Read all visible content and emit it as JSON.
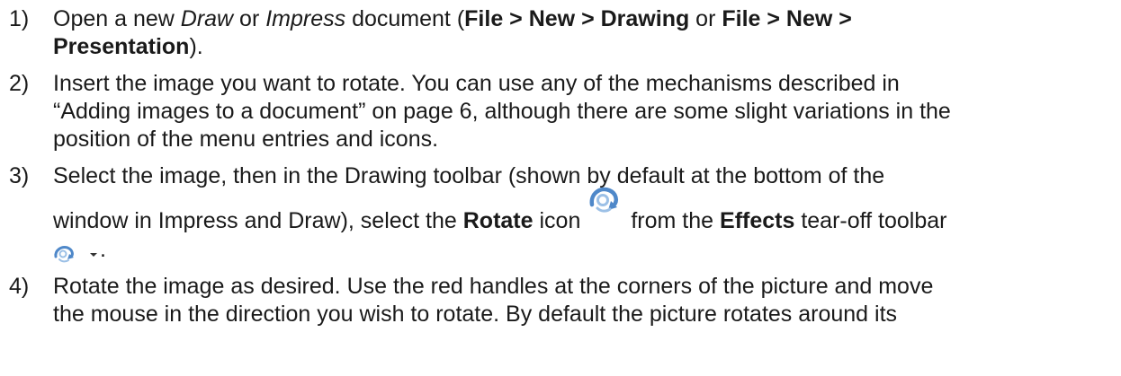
{
  "steps": [
    {
      "num": "1)",
      "t1": "Open a new ",
      "draw": "Draw",
      "t2": " or ",
      "impress": "Impress",
      "t3": " document (",
      "b1": "File > New > Drawing",
      "t4": " or ",
      "b2": "File > New >",
      "b3": "Presentation",
      "t5": ")."
    },
    {
      "num": "2)",
      "l1": "Insert the image you want to rotate. You can use any of the mechanisms described in",
      "l2": "“Adding images to a document” on page 6, although there are some slight variations in the",
      "l3": "position of the menu entries and icons."
    },
    {
      "num": "3)",
      "l1": "Select the image, then in the Drawing toolbar (shown by default at the bottom of the",
      "t1": "window in Impress and Draw), select the ",
      "rotate": "Rotate",
      "t2": " icon",
      "t3": "from the ",
      "effects": "Effects",
      "t4": " tear-off toolbar",
      "end": "."
    },
    {
      "num": "4)",
      "l1": "Rotate the image as desired. Use the red handles at the corners of the picture and move",
      "l2": "the mouse in the direction you wish to rotate. By default the picture rotates around its"
    }
  ],
  "icons": {
    "rotate": "rotate-icon",
    "effects": "effects-toolbar-icon",
    "dropdown": "chevron-down-icon",
    "accent": "#6f9fd4"
  }
}
